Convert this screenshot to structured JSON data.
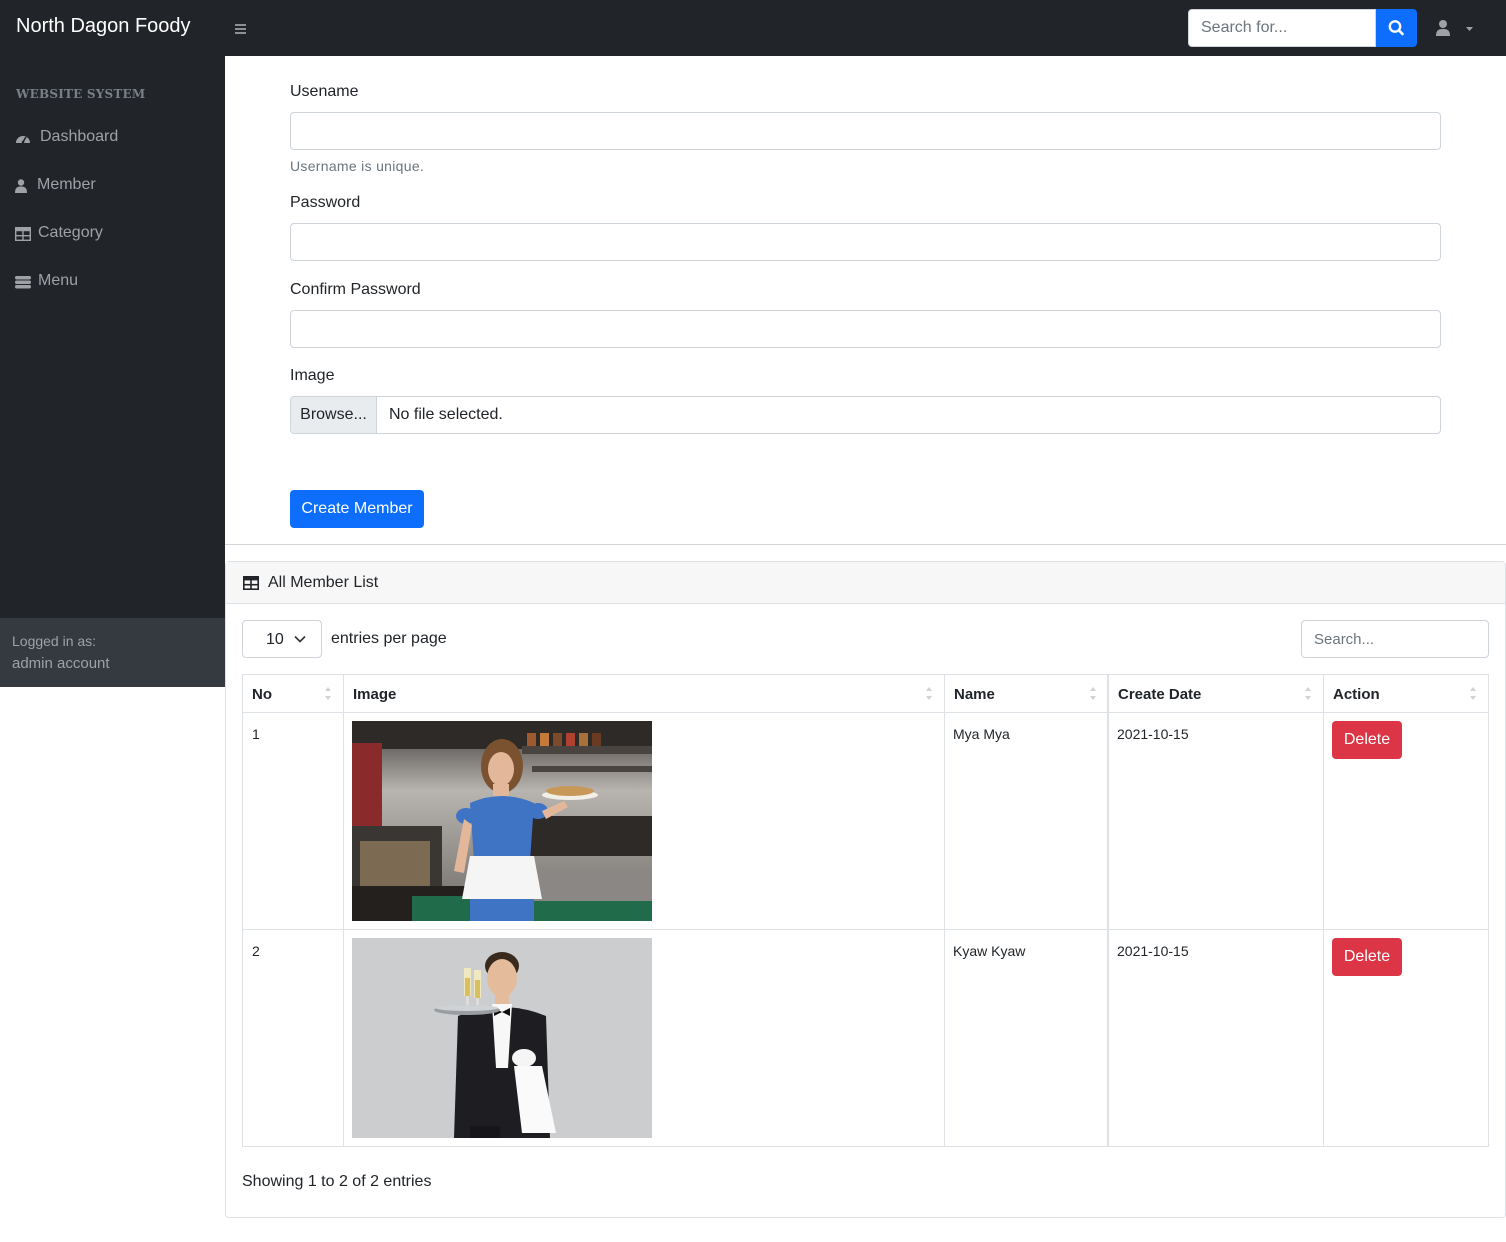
{
  "app": {
    "brand": "North Dagon Foody"
  },
  "topbar": {
    "search_placeholder": "Search for..."
  },
  "sidebar": {
    "heading": "WEBSITE SYSTEM",
    "items": [
      {
        "label": "Dashboard",
        "icon": "tachometer-icon"
      },
      {
        "label": "Member",
        "icon": "user-icon"
      },
      {
        "label": "Category",
        "icon": "table-icon"
      },
      {
        "label": "Menu",
        "icon": "database-icon"
      }
    ],
    "footer": {
      "logged_label": "Logged in as:",
      "user": "admin account"
    }
  },
  "form": {
    "username_label": "Usename",
    "username_help": "Username is unique.",
    "password_label": "Password",
    "confirm_label": "Confirm Password",
    "image_label": "Image",
    "browse_label": "Browse...",
    "file_status": "No file selected.",
    "submit_label": "Create Member"
  },
  "list": {
    "title": "All Member List",
    "per_page_value": "10",
    "per_page_text": "entries per page",
    "search_placeholder": "Search...",
    "columns": [
      "No",
      "Image",
      "Name",
      "Create Date",
      "Action"
    ],
    "rows": [
      {
        "no": "1",
        "name": "Mya Mya",
        "date": "2021-10-15",
        "action": "Delete",
        "image": "waitress-photo"
      },
      {
        "no": "2",
        "name": "Kyaw Kyaw",
        "date": "2021-10-15",
        "action": "Delete",
        "image": "waiter-photo"
      }
    ],
    "showing": "Showing 1 to 2 of 2 entries"
  },
  "colors": {
    "primary": "#0d6efd",
    "danger": "#dc3545",
    "dark": "#212529"
  }
}
